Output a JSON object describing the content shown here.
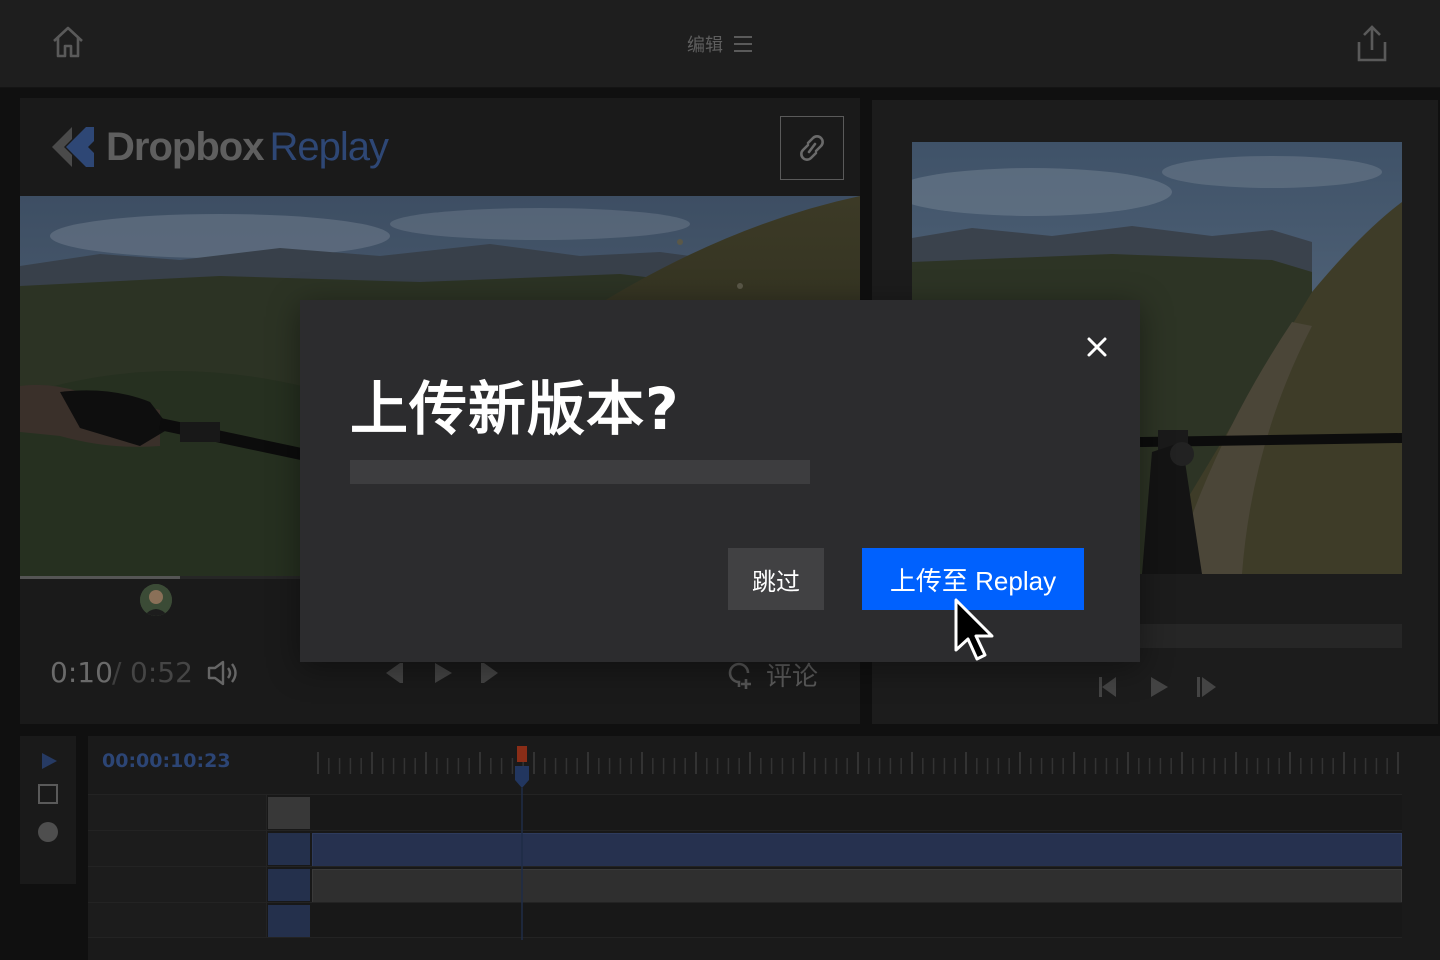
{
  "topbar": {
    "edit_menu_label": "编辑"
  },
  "brand": {
    "name_primary": "Dropbox",
    "name_secondary": "Replay"
  },
  "player": {
    "current_time": "0:10",
    "separator": "/",
    "total_time": "0:52",
    "comment_label": "评论",
    "progress": 0.19
  },
  "timeline": {
    "timecode": "00:00:10:23"
  },
  "dialog": {
    "title": "上传新版本?",
    "skip_label": "跳过",
    "upload_label": "上传至 Replay",
    "upload_progress": 0
  },
  "colors": {
    "accent": "#0061fe",
    "clip_blue": "#26314f",
    "clip_gray": "#343434",
    "playhead": "#b5361a"
  },
  "icons": [
    "home-icon",
    "menu-icon",
    "share-icon",
    "link-icon",
    "volume-icon",
    "prev-frame-icon",
    "play-icon",
    "next-frame-icon",
    "comment-add-icon",
    "close-icon",
    "stop-icon",
    "record-icon",
    "cursor-icon"
  ]
}
